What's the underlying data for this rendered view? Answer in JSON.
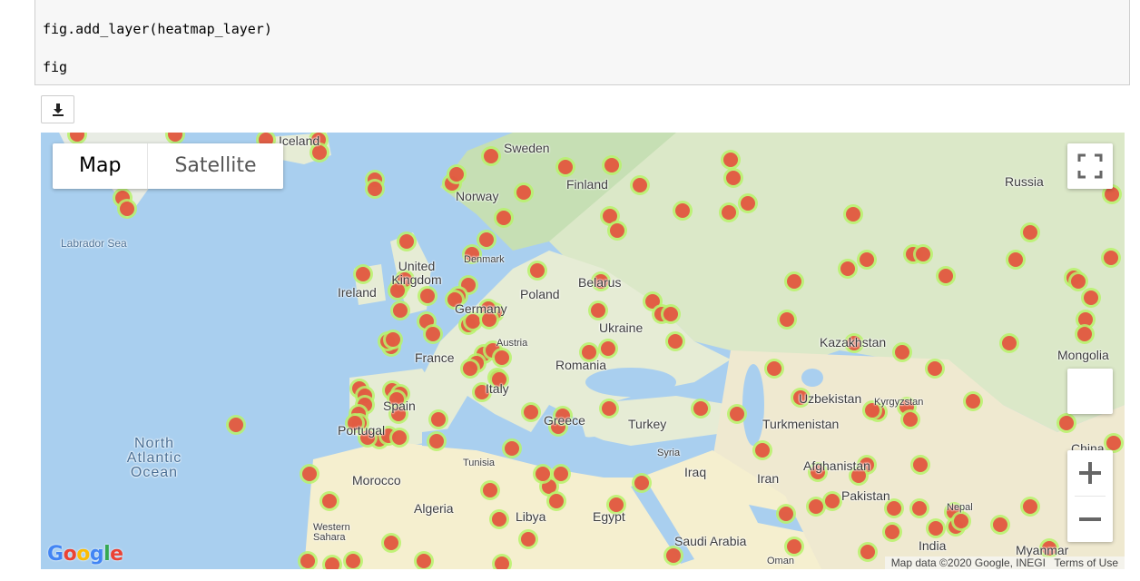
{
  "code_cell": {
    "lines": [
      "fig.add_layer(heatmap_layer)",
      "fig"
    ]
  },
  "download_button": {
    "icon": "download-icon"
  },
  "map": {
    "type_control": {
      "map_label": "Map",
      "satellite_label": "Satellite",
      "selected": "Map"
    },
    "controls": {
      "fullscreen_icon": "fullscreen-icon",
      "zoom_in_label": "+",
      "zoom_out_label": "−"
    },
    "labels": [
      "Iceland",
      "Sweden",
      "Finland",
      "Norway",
      "Russia",
      "Labrador Sea",
      "Denmark",
      "United Kingdom",
      "Ireland",
      "Poland",
      "Belarus",
      "Germany",
      "Ukraine",
      "Kazakhstan",
      "Mongolia",
      "Austria",
      "France",
      "Romania",
      "Italy",
      "Uzbekistan",
      "Kyrgyzstan",
      "Spain",
      "Greece",
      "Turkey",
      "Turkmenistan",
      "North Atlantic Ocean",
      "Portugal",
      "China",
      "Syria",
      "Tunisia",
      "Iraq",
      "Iran",
      "Afghanistan",
      "Morocco",
      "Algeria",
      "Pakistan",
      "Libya",
      "Egypt",
      "Nepal",
      "Western Sahara",
      "Saudi Arabia",
      "India",
      "Myanmar",
      "Oman"
    ],
    "attribution": "Map data ©2020 Google, INEGI",
    "terms": "Terms of Use",
    "logo_text": "Google",
    "colors": {
      "water": "#a9cfef",
      "land": "#e6ecd5",
      "forest": "#c6dfb4",
      "desert": "#f5efcf",
      "heat_core": "#e8453c",
      "heat_halo": "#b7f26a"
    }
  }
}
